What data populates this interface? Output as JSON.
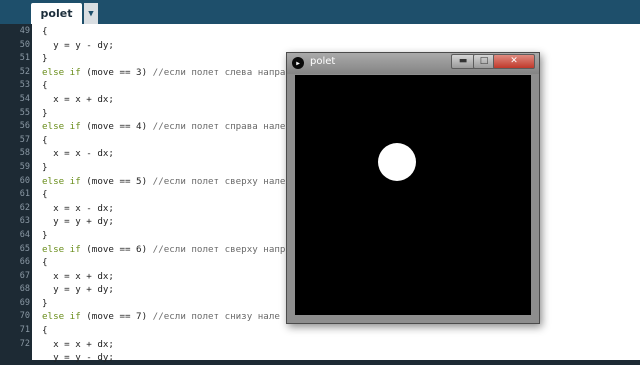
{
  "tab": {
    "label": "polet",
    "menu_glyph": "▼"
  },
  "line_numbers": [
    "49",
    "50",
    "51",
    "52",
    "53",
    "54",
    "55",
    "56",
    "57",
    "58",
    "59",
    "60",
    "61",
    "62",
    "63",
    "64",
    "65",
    "66",
    "67",
    "68",
    "69",
    "70",
    "71",
    "72"
  ],
  "code": {
    "l49": "{",
    "l50": "  y = y - dy;",
    "l51": "}",
    "l52_kw": "else if",
    "l52_rest": " (move == 3) ",
    "l52_cm": "//если полет слева напра",
    "l53": "{",
    "l54": "  x = x + dx;",
    "l55": "}",
    "l56_kw": "else if",
    "l56_rest": " (move == 4) ",
    "l56_cm": "//если полет справа нале",
    "l57": "{",
    "l58": "  x = x - dx;",
    "l59": "}",
    "l60_kw": "else if",
    "l60_rest": " (move == 5) ",
    "l60_cm": "//если полет сверху нале",
    "l61": "{",
    "l62": "  x = x - dx;",
    "l63": "  y = y + dy;",
    "l64": "}",
    "l65_kw": "else if",
    "l65_rest": " (move == 6) ",
    "l65_cm": "//если полет сверху напр",
    "l66": "{",
    "l67": "  x = x + dx;",
    "l68": "  y = y + dy;",
    "l69": "}",
    "l70_kw": "else if",
    "l70_rest": " (move == 7) ",
    "l70_cm": "//если полет снизу нале",
    "l71": "{",
    "l72": "  x = x + dx;",
    "l73": "  y = y - dy;"
  },
  "sketch_window": {
    "title": "polet",
    "icon": "play-icon",
    "minimize_glyph": "▬",
    "maximize_glyph": "□",
    "close_glyph": "✕"
  },
  "colors": {
    "keyword": "#6a8e1c",
    "tabbar": "#1e4f6b",
    "canvas": "#000000",
    "ball": "#ffffff"
  }
}
